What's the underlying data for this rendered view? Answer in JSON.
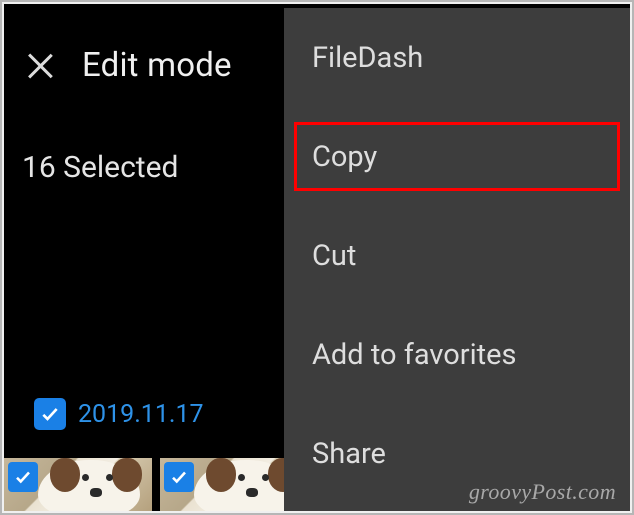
{
  "header": {
    "title": "Edit mode"
  },
  "selection": {
    "count_label": "16 Selected"
  },
  "date_group": {
    "date_label": "2019.11.17",
    "checked": true
  },
  "thumbnails": [
    {
      "checked": true
    },
    {
      "checked": true
    }
  ],
  "menu": {
    "items": [
      {
        "label": "FileDash",
        "highlight": false
      },
      {
        "label": "Copy",
        "highlight": true
      },
      {
        "label": "Cut",
        "highlight": false
      },
      {
        "label": "Add to favorites",
        "highlight": false
      },
      {
        "label": "Share",
        "highlight": false
      }
    ]
  },
  "watermark": "groovyPost.com"
}
